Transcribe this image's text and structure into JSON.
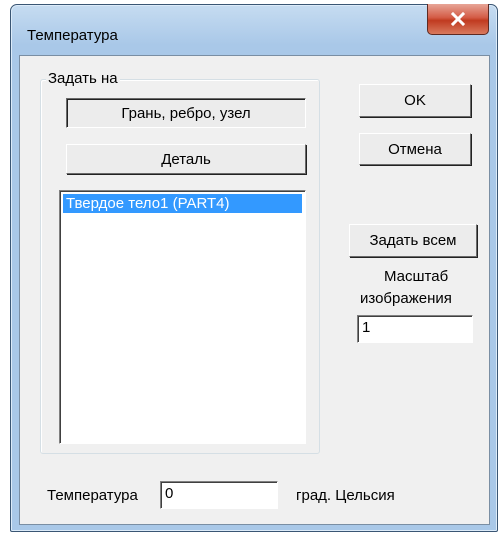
{
  "window": {
    "title": "Температура"
  },
  "close_icon": "close-x-icon",
  "group": {
    "legend": "Задать на",
    "face_button": "Грань, ребро, узел",
    "part_button": "Деталь",
    "list_items": [
      "Твердое тело1 (PART4)"
    ]
  },
  "buttons": {
    "ok": "OK",
    "cancel": "Отмена",
    "set_all": "Задать всем"
  },
  "scale": {
    "label_line1": "Масштаб",
    "label_line2": "изображения",
    "value": "1"
  },
  "temperature": {
    "label": "Температура",
    "value": "0",
    "unit": "град. Цельсия"
  },
  "colors": {
    "selection": "#3399ff",
    "close_button": "#c8452c",
    "frame": "#a9c8e8"
  }
}
